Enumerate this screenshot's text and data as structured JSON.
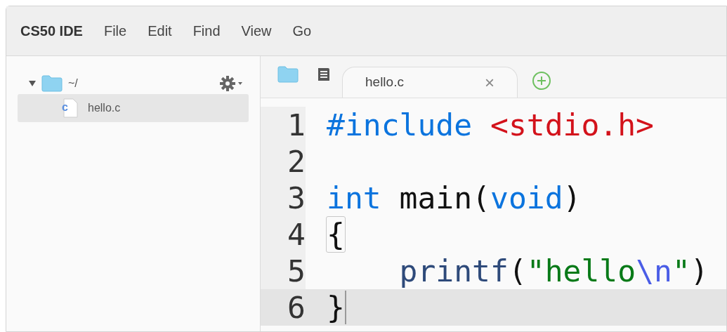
{
  "menu_bar": {
    "brand": "CS50 IDE",
    "items": [
      "File",
      "Edit",
      "Find",
      "View",
      "Go"
    ]
  },
  "file_tree": {
    "root": {
      "label": "~/",
      "expanded": true,
      "children": [
        {
          "label": "hello.c",
          "icon_letter": "c",
          "selected": true
        }
      ]
    }
  },
  "editor": {
    "tabs": [
      {
        "label": "hello.c",
        "close": "×",
        "selected": true
      }
    ],
    "lines": [
      {
        "number": "1",
        "active": false,
        "tokens": [
          {
            "kind": "keyword",
            "text": "#include"
          },
          {
            "kind": "header",
            "text": " <stdio.h>"
          }
        ]
      },
      {
        "number": "2",
        "active": false
      },
      {
        "number": "3",
        "active": false,
        "tokens": [
          {
            "kind": "keyword",
            "text": "int"
          },
          {
            "kind": "plain",
            "text": " main("
          },
          {
            "kind": "keyword",
            "text": "void"
          },
          {
            "kind": "plain",
            "text": ")"
          }
        ]
      },
      {
        "number": "4",
        "active": false,
        "tokens": [
          {
            "kind": "bracket-match",
            "text": "{"
          }
        ]
      },
      {
        "number": "5",
        "active": false,
        "tokens": [
          {
            "kind": "function",
            "text": "    printf"
          },
          {
            "kind": "plain",
            "text": "("
          },
          {
            "kind": "string",
            "text": "\"hello"
          },
          {
            "kind": "escape",
            "text": "\\n"
          },
          {
            "kind": "string",
            "text": "\""
          },
          {
            "kind": "plain",
            "text": ")"
          }
        ]
      },
      {
        "number": "6",
        "active": true,
        "cursor": true,
        "tokens": [
          {
            "kind": "plain",
            "text": "}"
          }
        ]
      }
    ]
  }
}
